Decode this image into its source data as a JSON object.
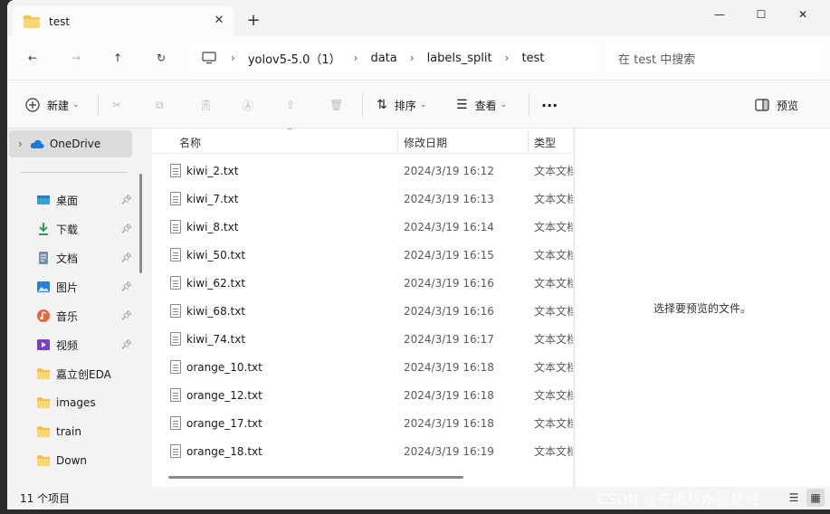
{
  "tab": {
    "title": "test",
    "close": "✕",
    "new": "+"
  },
  "window_controls": {
    "minimize": "—",
    "maximize": "☐",
    "close": "✕"
  },
  "nav": {
    "back": "←",
    "forward": "→",
    "up": "↑",
    "refresh": "↻",
    "breadcrumbs": [
      "yolov5-5.0（1）",
      "data",
      "labels_split",
      "test"
    ],
    "search_placeholder": "在 test 中搜索"
  },
  "toolbar": {
    "new_label": "新建",
    "sort_label": "排序",
    "view_label": "查看",
    "more_label": "···",
    "preview_label": "预览"
  },
  "sidebar": {
    "top": {
      "label": "OneDrive"
    },
    "items": [
      {
        "label": "桌面",
        "icon": "desktop-icon",
        "pinned": true
      },
      {
        "label": "下载",
        "icon": "download-icon",
        "pinned": true
      },
      {
        "label": "文档",
        "icon": "document-icon",
        "pinned": true
      },
      {
        "label": "图片",
        "icon": "pictures-icon",
        "pinned": true
      },
      {
        "label": "音乐",
        "icon": "music-icon",
        "pinned": true
      },
      {
        "label": "视频",
        "icon": "video-icon",
        "pinned": true
      },
      {
        "label": "嘉立创EDA",
        "icon": "folder-icon",
        "pinned": false
      },
      {
        "label": "images",
        "icon": "folder-icon",
        "pinned": false
      },
      {
        "label": "train",
        "icon": "folder-icon",
        "pinned": false
      },
      {
        "label": "Down",
        "icon": "folder-icon",
        "pinned": false
      }
    ]
  },
  "list": {
    "columns": [
      "名称",
      "修改日期",
      "类型"
    ],
    "files": [
      {
        "name": "kiwi_2.txt",
        "date": "2024/3/19 16:12",
        "type": "文本文档"
      },
      {
        "name": "kiwi_7.txt",
        "date": "2024/3/19 16:13",
        "type": "文本文档"
      },
      {
        "name": "kiwi_8.txt",
        "date": "2024/3/19 16:14",
        "type": "文本文档"
      },
      {
        "name": "kiwi_50.txt",
        "date": "2024/3/19 16:15",
        "type": "文本文档"
      },
      {
        "name": "kiwi_62.txt",
        "date": "2024/3/19 16:16",
        "type": "文本文档"
      },
      {
        "name": "kiwi_68.txt",
        "date": "2024/3/19 16:16",
        "type": "文本文档"
      },
      {
        "name": "kiwi_74.txt",
        "date": "2024/3/19 16:17",
        "type": "文本文档"
      },
      {
        "name": "orange_10.txt",
        "date": "2024/3/19 16:18",
        "type": "文本文档"
      },
      {
        "name": "orange_12.txt",
        "date": "2024/3/19 16:18",
        "type": "文本文档"
      },
      {
        "name": "orange_17.txt",
        "date": "2024/3/19 16:18",
        "type": "文本文档"
      },
      {
        "name": "orange_18.txt",
        "date": "2024/3/19 16:19",
        "type": "文本文档"
      }
    ]
  },
  "preview": {
    "message": "选择要预览的文件。"
  },
  "status": {
    "count": "11 个项目"
  },
  "watermark": "CSDN @亦携秋水揽星河",
  "colors": {
    "folder": "#f2c14e",
    "onedrive": "#1b78d6",
    "accent": "#0067c0"
  }
}
